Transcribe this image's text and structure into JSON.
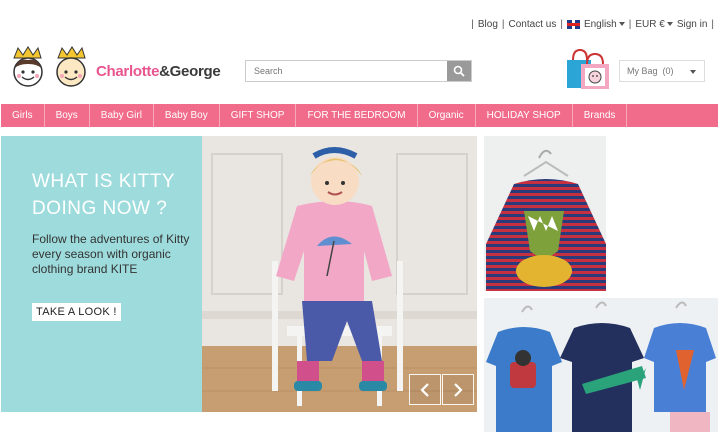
{
  "topbar": {
    "blog": "Blog",
    "contact": "Contact us",
    "language": "English",
    "currency": "EUR €",
    "signin": "Sign in"
  },
  "logo": {
    "part1": "Charlotte",
    "part2": "&George"
  },
  "search": {
    "placeholder": "Search"
  },
  "bag": {
    "label": "My Bag",
    "count": "(0)"
  },
  "nav": [
    "Girls",
    "Boys",
    "Baby Girl",
    "Baby Boy",
    "GIFT SHOP",
    "FOR THE BEDROOM",
    "Organic",
    "HOLIDAY SHOP",
    "Brands"
  ],
  "hero": {
    "title": "WHAT IS KITTY DOING NOW ?",
    "text": "Follow the adventures of Kitty every season with organic clothing brand KITE",
    "button": "TAKE A LOOK !"
  },
  "colors": {
    "nav": "#f06c8a",
    "hero_panel": "#9edbdc",
    "brand_pink": "#e8558f"
  }
}
